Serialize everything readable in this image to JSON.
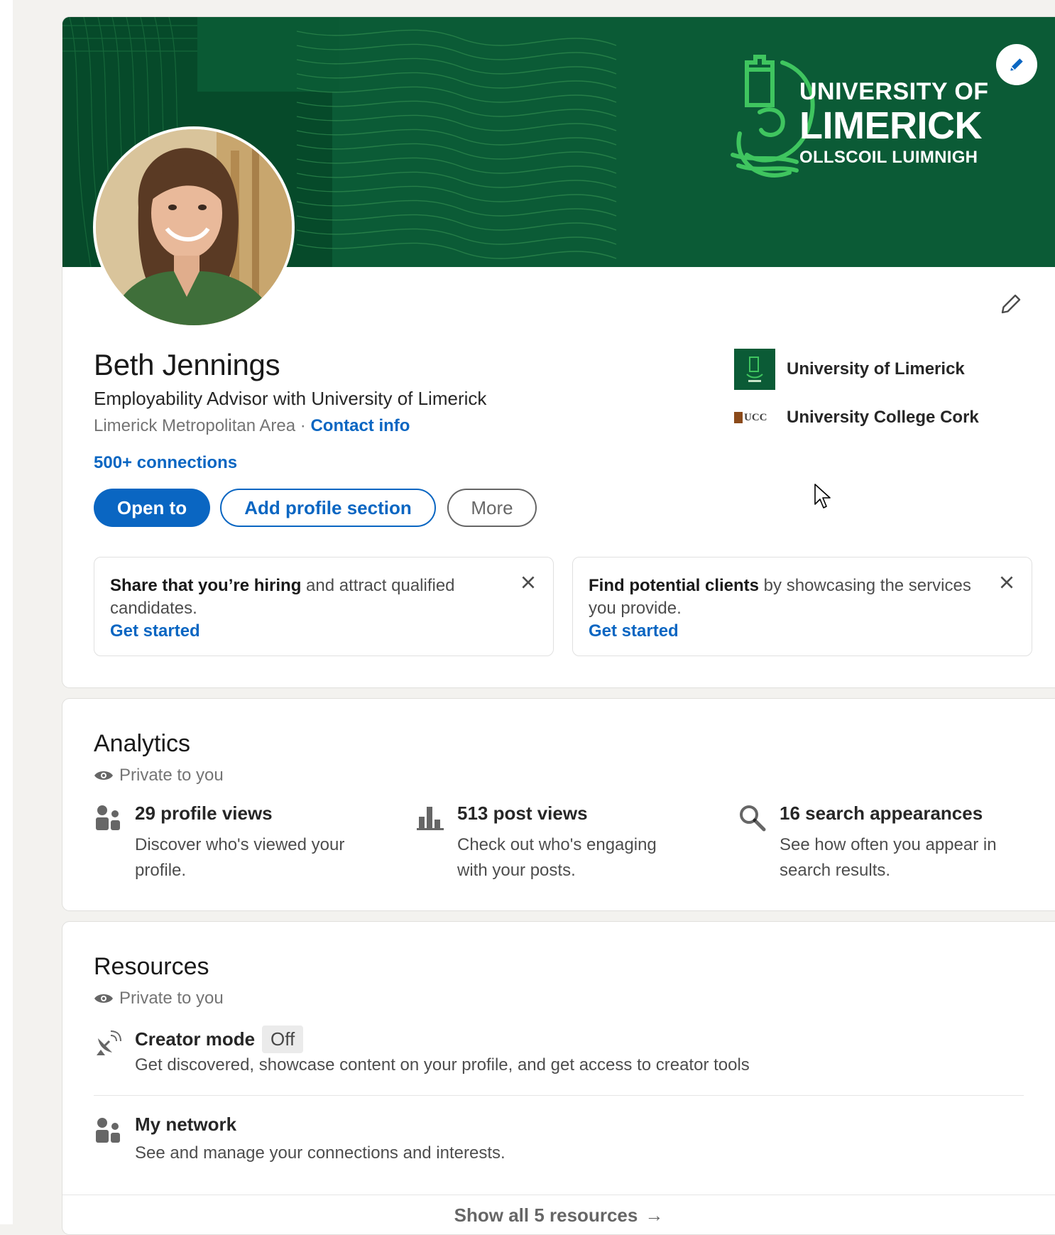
{
  "banner": {
    "logo_line1": "UNIVERSITY OF",
    "logo_line2": "LIMERICK",
    "logo_line3": "OLLSCOIL LUIMNIGH"
  },
  "profile": {
    "name": "Beth Jennings",
    "headline": "Employability Advisor with University of Limerick",
    "location": "Limerick Metropolitan Area",
    "separator": " · ",
    "contact_info": "Contact info",
    "connections": "500+ connections"
  },
  "actions": {
    "open_to": "Open to",
    "add_section": "Add profile section",
    "more": "More"
  },
  "organizations": [
    {
      "name": "University of Limerick"
    },
    {
      "name": "University College Cork",
      "logo_text": "UCC"
    }
  ],
  "promos": [
    {
      "strong": "Share that you’re hiring",
      "rest": " and attract qualified candidates.",
      "link": "Get started"
    },
    {
      "strong": "Find potential clients",
      "rest": " by showcasing the services you provide.",
      "link": "Get started"
    }
  ],
  "analytics": {
    "title": "Analytics",
    "private": "Private to you",
    "stats": [
      {
        "title": "29 profile views",
        "desc": "Discover who's viewed your profile."
      },
      {
        "title": "513 post views",
        "desc": "Check out who's engaging with your posts."
      },
      {
        "title": "16 search appearances",
        "desc": "See how often you appear in search results."
      }
    ]
  },
  "resources": {
    "title": "Resources",
    "private": "Private to you",
    "items": [
      {
        "title": "Creator mode",
        "badge": "Off",
        "desc": "Get discovered, showcase content on your profile, and get access to creator tools"
      },
      {
        "title": "My network",
        "desc": "See and manage your connections and interests."
      }
    ],
    "show_all": "Show all 5 resources",
    "arrow": "→"
  },
  "colors": {
    "brand_blue": "#0a66c2",
    "banner_green": "#0b5b36"
  }
}
